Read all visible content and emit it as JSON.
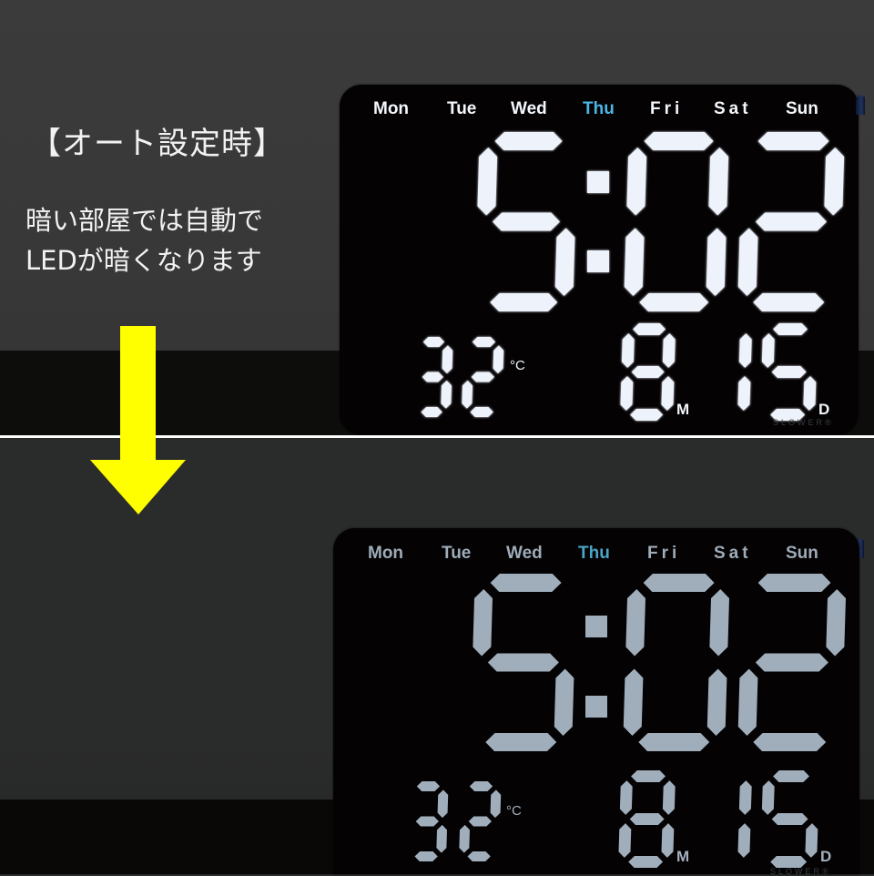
{
  "caption": {
    "heading": "【オート設定時】",
    "description_lines": [
      "暗い部屋では自動で",
      "LEDが暗くなります"
    ]
  },
  "colors": {
    "arrow": "#ffff00",
    "bright_segment": "#eef3fb",
    "dim_segment": "#a0aebb",
    "active_day_bright": "#4db6e6",
    "active_day_dim": "#4aa6c5"
  },
  "clocks": [
    {
      "state": "bright",
      "weekdays": [
        "Mon",
        "Tue",
        "Wed",
        "Thu",
        "Fri",
        "Sat",
        "Sun"
      ],
      "active_weekday": "Thu",
      "time": {
        "hours": "5",
        "minutes": "02"
      },
      "temperature": {
        "value": "32",
        "unit": "°C"
      },
      "date": {
        "month": "8",
        "month_unit": "M",
        "day": "15",
        "day_unit": "D"
      },
      "brand": "SLOWER®"
    },
    {
      "state": "dimmed",
      "weekdays": [
        "Mon",
        "Tue",
        "Wed",
        "Thu",
        "Fri",
        "Sat",
        "Sun"
      ],
      "active_weekday": "Thu",
      "time": {
        "hours": "5",
        "minutes": "02"
      },
      "temperature": {
        "value": "32",
        "unit": "°C"
      },
      "date": {
        "month": "8",
        "month_unit": "M",
        "day": "15",
        "day_unit": "D"
      },
      "brand": "SLOWER®"
    }
  ],
  "icons": {
    "arrow": "down-arrow-icon",
    "colon": "colon-dots"
  }
}
